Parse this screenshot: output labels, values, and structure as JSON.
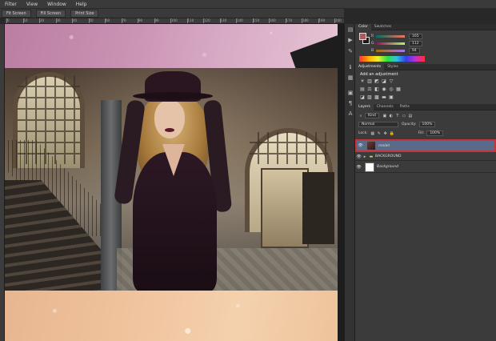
{
  "menu": [
    "Filter",
    "View",
    "Window",
    "Help"
  ],
  "options_bar": [
    "Fit Screen",
    "Fill Screen",
    "Print Size"
  ],
  "ruler_ticks": [
    "0",
    "10",
    "20",
    "30",
    "40",
    "50",
    "60",
    "70",
    "80",
    "90",
    "100",
    "110",
    "120",
    "130",
    "140",
    "150",
    "160",
    "170",
    "180",
    "190",
    "200"
  ],
  "color_panel": {
    "tabs": [
      "Color",
      "Swatches"
    ],
    "fg_color": "#a55e5e",
    "bg_color": "#1a1a1a",
    "channels": [
      {
        "label": "R",
        "value": "165"
      },
      {
        "label": "G",
        "value": "112"
      },
      {
        "label": "B",
        "value": "94"
      }
    ]
  },
  "adjustments_panel": {
    "tabs": [
      "Adjustments",
      "Styles"
    ],
    "title": "Add an adjustment"
  },
  "layers_panel": {
    "tabs": [
      "Layers",
      "Channels",
      "Paths"
    ],
    "kind_label": "Kind",
    "blend_mode": "Normal",
    "opacity_label": "Opacity:",
    "opacity_value": "100%",
    "lock_label": "Lock:",
    "fill_label": "Fill:",
    "fill_value": "100%",
    "layers": [
      {
        "name": "model",
        "selected": true
      },
      {
        "name": "BACKGROUND",
        "type": "group"
      },
      {
        "name": "Background",
        "type": "background"
      }
    ]
  },
  "colors": {
    "selection_border": "#c8323c",
    "selected_row": "#5a6b8a"
  }
}
